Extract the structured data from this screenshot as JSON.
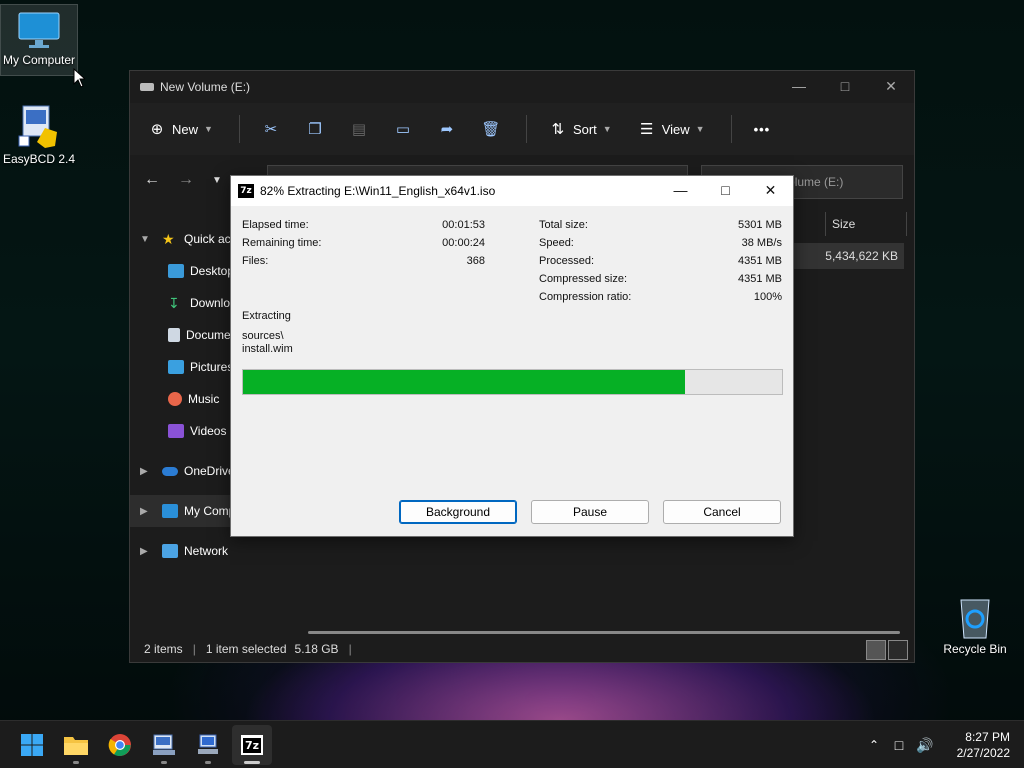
{
  "desktop": {
    "icons": [
      {
        "label": "My Computer"
      },
      {
        "label": "EasyBCD 2.4"
      },
      {
        "label": "Recycle Bin"
      }
    ]
  },
  "explorer": {
    "title": "New Volume (E:)",
    "toolbar": {
      "new_label": "New",
      "sort_label": "Sort",
      "view_label": "View",
      "more_label": "•••"
    },
    "search_placeholder": "Search New Volume (E:)",
    "sidebar": [
      {
        "label": "Quick access"
      },
      {
        "label": "Desktop"
      },
      {
        "label": "Downloads"
      },
      {
        "label": "Documents"
      },
      {
        "label": "Pictures"
      },
      {
        "label": "Music"
      },
      {
        "label": "Videos"
      },
      {
        "label": "OneDrive"
      },
      {
        "label": "My Computer"
      },
      {
        "label": "Network"
      }
    ],
    "column_size": "Size",
    "file_size": "5,434,622 KB",
    "status": {
      "items": "2 items",
      "selected": "1 item selected",
      "size": "5.18 GB"
    }
  },
  "dialog": {
    "title": "82% Extracting E:\\Win11_English_x64v1.iso",
    "progress_fraction": 0.82,
    "left_stats": [
      {
        "label": "Elapsed time:",
        "value": "00:01:53"
      },
      {
        "label": "Remaining time:",
        "value": "00:00:24"
      },
      {
        "label": "Files:",
        "value": "368"
      }
    ],
    "right_stats": [
      {
        "label": "Total size:",
        "value": "5301 MB"
      },
      {
        "label": "Speed:",
        "value": "38 MB/s"
      },
      {
        "label": "Processed:",
        "value": "4351 MB"
      },
      {
        "label": "Compressed size:",
        "value": "4351 MB"
      },
      {
        "label": "Compression ratio:",
        "value": "100%"
      }
    ],
    "status_label": "Extracting",
    "path_line1": "sources\\",
    "path_line2": "install.wim",
    "buttons": {
      "background": "Background",
      "pause": "Pause",
      "cancel": "Cancel"
    }
  },
  "taskbar": {
    "time": "8:27 PM",
    "date": "2/27/2022"
  },
  "colors": {
    "progress": "#06b025",
    "accent": "#0067c0"
  }
}
